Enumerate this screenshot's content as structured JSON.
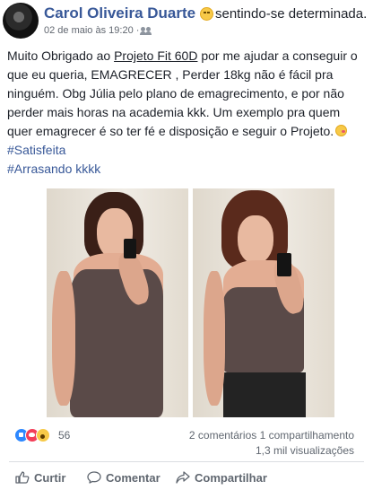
{
  "post": {
    "author": "Carol Oliveira Duarte",
    "feeling": "sentindo-se determinada.",
    "timestamp": "02 de maio às 19:20",
    "privacy_separator": "·",
    "privacy_icon": "friends-icon",
    "feeling_icon": "smiling-face-icon",
    "text": {
      "part1": "Muito Obrigado ao ",
      "link": "Projeto Fit 60D",
      "part2": " por me ajudar a conseguir o que eu queria, EMAGRECER , Perder  18kg não é fácil pra ninguém. Obg Júlia pelo plano de emagrecimento, e por não perder mais horas na academia kkk. Um exemplo pra quem quer emagrecer é so ter fé e disposição e seguir o Projeto.",
      "end_emoji": "winking-kiss-face-icon"
    },
    "hashtags": [
      "#Satisfeita",
      "#Arrasando kkkk"
    ],
    "photos": [
      "before-photo",
      "after-photo"
    ]
  },
  "stats": {
    "reaction_icons": [
      "like-icon",
      "love-icon",
      "wow-icon"
    ],
    "reactions_count": "56",
    "comments": "2 comentários",
    "shares": "1 compartilhamento",
    "views": "1,3 mil visualizações"
  },
  "actions": {
    "like": "Curtir",
    "comment": "Comentar",
    "share": "Compartilhar"
  },
  "colors": {
    "author_link": "#385898",
    "muted_text": "#606770",
    "divider": "#dadde1"
  }
}
